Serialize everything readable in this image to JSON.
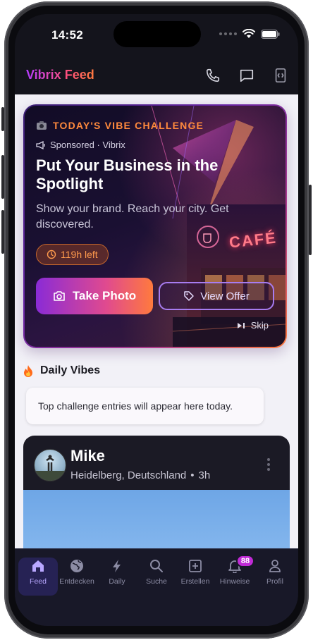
{
  "status_bar": {
    "time": "14:52"
  },
  "header": {
    "brand": "Vibrix Feed",
    "icons": [
      "phone-icon",
      "message-icon",
      "code-icon"
    ]
  },
  "challenge": {
    "tag": "TODAY'S VIBE CHALLENGE",
    "sponsored": "Sponsored · Vibrix",
    "title": "Put Your Business in the Spotlight",
    "description": "Show your brand. Reach your city. Get discovered.",
    "time_left": "119h left",
    "take_photo_label": "Take Photo",
    "view_offer_label": "View Offer",
    "skip_label": "Skip",
    "art_sign": "CAFÉ",
    "colors": {
      "accent": "#ff8a3d",
      "purple": "#8a2bd6",
      "pink": "#e04a8f"
    }
  },
  "daily": {
    "title": "Daily Vibes",
    "placeholder_text": "Top challenge entries will appear here today."
  },
  "post": {
    "author": "Mike",
    "location": "Heidelberg, Deutschland",
    "separator": "•",
    "age": "3h"
  },
  "tabs": [
    {
      "label": "Feed",
      "icon": "home-icon",
      "active": true
    },
    {
      "label": "Entdecken",
      "icon": "globe-icon",
      "active": false
    },
    {
      "label": "Daily",
      "icon": "bolt-icon",
      "active": false
    },
    {
      "label": "Suche",
      "icon": "search-icon",
      "active": false
    },
    {
      "label": "Erstellen",
      "icon": "plus-square-icon",
      "active": false
    },
    {
      "label": "Hinweise",
      "icon": "bell-icon",
      "active": false,
      "badge": "88"
    },
    {
      "label": "Profil",
      "icon": "user-icon",
      "active": false
    }
  ]
}
